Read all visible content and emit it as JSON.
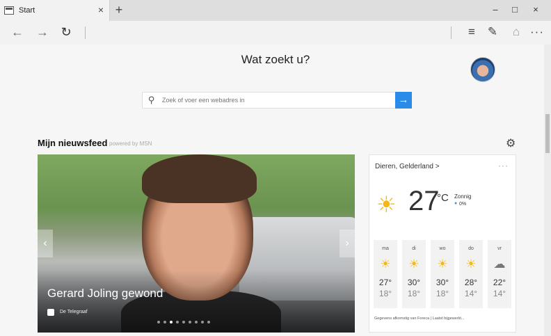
{
  "tab": {
    "title": "Start",
    "close": "×",
    "new_tab": "+"
  },
  "window_controls": {
    "minimize": "–",
    "maximize": "□",
    "close": "×"
  },
  "nav": {
    "back": "←",
    "forward": "→",
    "refresh": "↻",
    "hub": "≡",
    "note": "✎",
    "share": "⌂",
    "more": "···"
  },
  "page": {
    "headline": "Wat zoekt u?",
    "search": {
      "placeholder": "Zoek of voer een webadres in",
      "go": "→"
    },
    "feed": {
      "title": "Mijn nieuwsfeed",
      "powered_by": "powered by MSN"
    }
  },
  "hero": {
    "title": "Gerard Joling gewond",
    "source": "De Telegraaf",
    "prev": "‹",
    "next": "›",
    "dot_count": 9,
    "active_dot": 2
  },
  "weather": {
    "location": "Dieren, Gelderland >",
    "more": "···",
    "temperature": "27",
    "unit": "°C",
    "condition": "Zonnig",
    "precipitation": "0%",
    "forecast": [
      {
        "day": "ma",
        "icon": "sun-icon",
        "high": "27°",
        "low": "18°"
      },
      {
        "day": "di",
        "icon": "sun-icon",
        "high": "30°",
        "low": "18°"
      },
      {
        "day": "wo",
        "icon": "sun-icon",
        "high": "30°",
        "low": "18°"
      },
      {
        "day": "do",
        "icon": "sun-icon",
        "high": "28°",
        "low": "14°"
      },
      {
        "day": "vr",
        "icon": "cloud-icon",
        "high": "22°",
        "low": "14°"
      }
    ],
    "footer": "Gegevens afkomstig van Foreca | Laatst bijgewerkt..."
  },
  "colors": {
    "accent": "#2b8be8",
    "sun": "#f3b816"
  }
}
